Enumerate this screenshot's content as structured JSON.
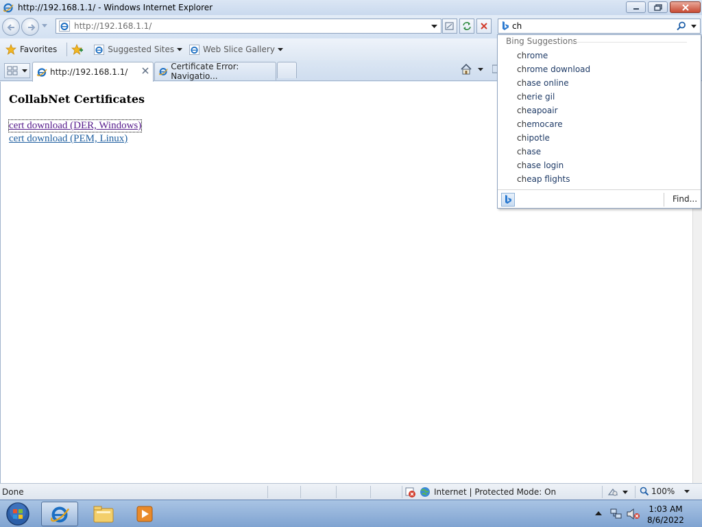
{
  "window": {
    "title": "http://192.168.1.1/ - Windows Internet Explorer"
  },
  "navigation": {
    "address": "http://192.168.1.1/"
  },
  "search": {
    "value": "ch",
    "provider": "Bing",
    "suggestions_header": "Bing Suggestions",
    "suggestions": [
      {
        "prefix": "ch",
        "rest": "rome"
      },
      {
        "prefix": "ch",
        "rest": "rome download"
      },
      {
        "prefix": "ch",
        "rest": "ase online"
      },
      {
        "prefix": "ch",
        "rest": "erie gil"
      },
      {
        "prefix": "ch",
        "rest": "eapoair"
      },
      {
        "prefix": "ch",
        "rest": "emocare"
      },
      {
        "prefix": "ch",
        "rest": "ipotle"
      },
      {
        "prefix": "ch",
        "rest": "ase"
      },
      {
        "prefix": "ch",
        "rest": "ase login"
      },
      {
        "prefix": "ch",
        "rest": "eap flights"
      }
    ],
    "find_label": "Find..."
  },
  "favorites_bar": {
    "favorites_label": "Favorites",
    "suggested_sites": "Suggested Sites",
    "web_slice_gallery": "Web Slice Gallery"
  },
  "tabs": [
    {
      "label": "http://192.168.1.1/",
      "active": true
    },
    {
      "label": "Certificate Error: Navigatio...",
      "active": false
    }
  ],
  "page": {
    "heading": "CollabNet Certificates",
    "links": [
      {
        "label": "cert download (DER, Windows)",
        "visited": true
      },
      {
        "label": "cert download (PEM, Linux)",
        "visited": false
      }
    ]
  },
  "status": {
    "text": "Done",
    "zone": "Internet | Protected Mode: On",
    "zoom": "100%"
  },
  "taskbar": {
    "time": "1:03 AM",
    "date": "8/6/2022"
  },
  "colors": {
    "visited_link": "#551a8b",
    "link": "#1f5fa0",
    "ie_blue": "#1b6ec2",
    "bing_blue": "#2d7bd1"
  }
}
